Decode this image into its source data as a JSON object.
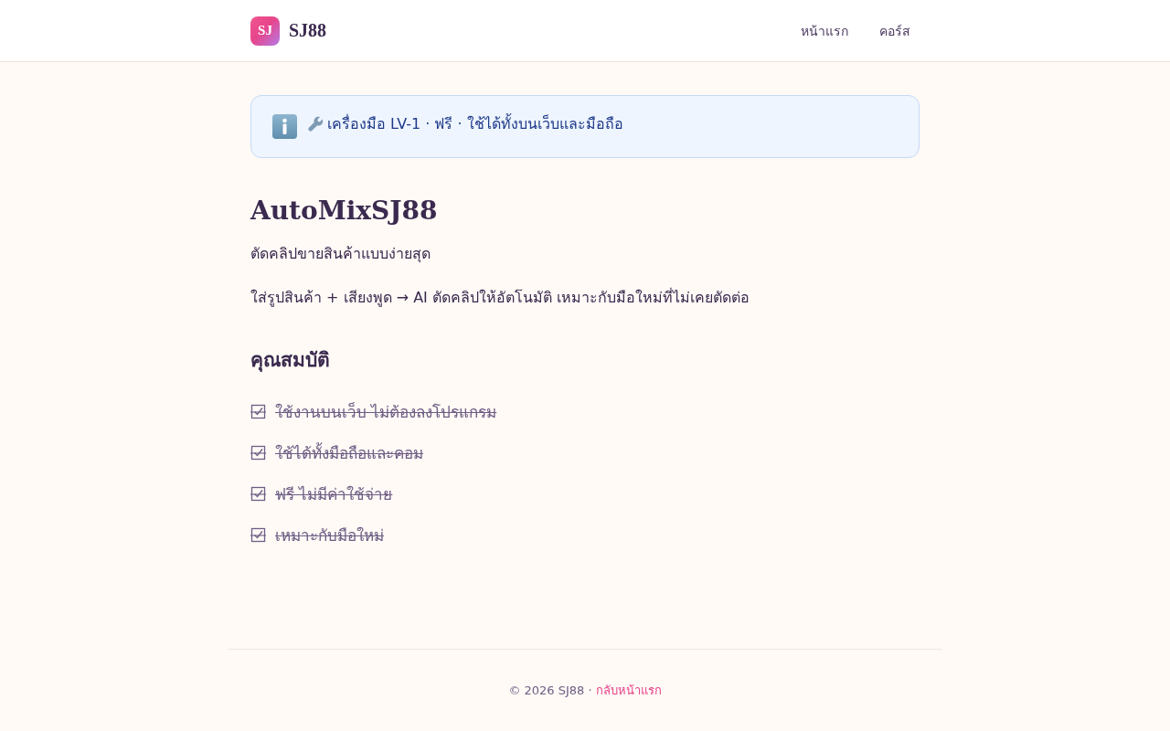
{
  "header": {
    "logo": {
      "mark": "SJ",
      "name": "SJ88"
    },
    "nav": [
      {
        "label": "หน้าแรก"
      },
      {
        "label": "คอร์ส"
      }
    ]
  },
  "notice": {
    "text": "เครื่องมือ LV-1 · ฟรี · ใช้ได้ทั้งบนเว็บและมือถือ"
  },
  "page": {
    "title": "AutoMixSJ88",
    "subtitle": "ตัดคลิปขายสินค้าแบบง่ายสุด",
    "description": "ใส่รูปสินค้า + เสียงพูด → AI ตัดคลิปให้อัตโนมัติ เหมาะกับมือใหม่ที่ไม่เคยตัดต่อ"
  },
  "features": {
    "heading": "คุณสมบัติ",
    "items": [
      {
        "label": "ใช้งานบนเว็บ ไม่ต้องลงโปรแกรม",
        "checked": true
      },
      {
        "label": "ใช้ได้ทั้งมือถือและคอม",
        "checked": true
      },
      {
        "label": "ฟรี ไม่มีค่าใช้จ่าย",
        "checked": true
      },
      {
        "label": "เหมาะกับมือใหม่",
        "checked": true
      }
    ]
  },
  "footer": {
    "copyright": "© 2026 SJ88 ·",
    "link": "กลับหน้าแรก"
  }
}
